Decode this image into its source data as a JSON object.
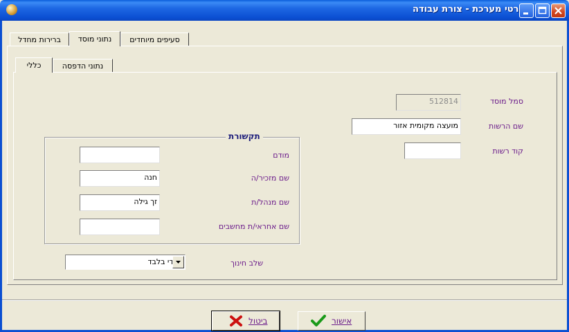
{
  "window": {
    "title": "פרטי מערכת - צורת עבודה"
  },
  "main_tabs": [
    {
      "label": "סעיפים מיוחדים",
      "active": false
    },
    {
      "label": "נתוני מוסד",
      "active": true
    },
    {
      "label": "ברירות מחדל",
      "active": false
    }
  ],
  "sub_tabs": [
    {
      "label": "כללי",
      "active": true
    },
    {
      "label": "נתוני הדפסה",
      "active": false
    }
  ],
  "institution": {
    "symbol_label": "סמל מוסד",
    "symbol_value": "512814",
    "authority_name_label": "שם הרשות",
    "authority_name_value": "מועצה מקומית אזור",
    "authority_code_label": "קוד רשות",
    "authority_code_value": ""
  },
  "communication": {
    "title": "תקשורת",
    "modem_label": "מודם",
    "modem_value": "",
    "secretary_label": "שם מזכיר/ה",
    "secretary_value": "חנה",
    "manager_label": "שם מנהל/ת",
    "manager_value": "זך גילה",
    "computer_admin_label": "שם אחראי/ת מחשבים",
    "computer_admin_value": ""
  },
  "education_stage": {
    "label": "שלב חינוך",
    "selected": "יסודי בלבד"
  },
  "buttons": {
    "cancel_label": "ביטול",
    "confirm_label": "אישור"
  },
  "colors": {
    "label_text": "#6a1a8a",
    "titlebar": "#0b4fd2",
    "dialog_bg": "#ece9d8",
    "cancel_icon": "#cc1010",
    "confirm_icon": "#1a9a1a"
  },
  "icons": {
    "app": "app-icon",
    "cancel": "x-mark-icon",
    "confirm": "check-mark-icon",
    "dropdown": "chevron-down-icon"
  }
}
